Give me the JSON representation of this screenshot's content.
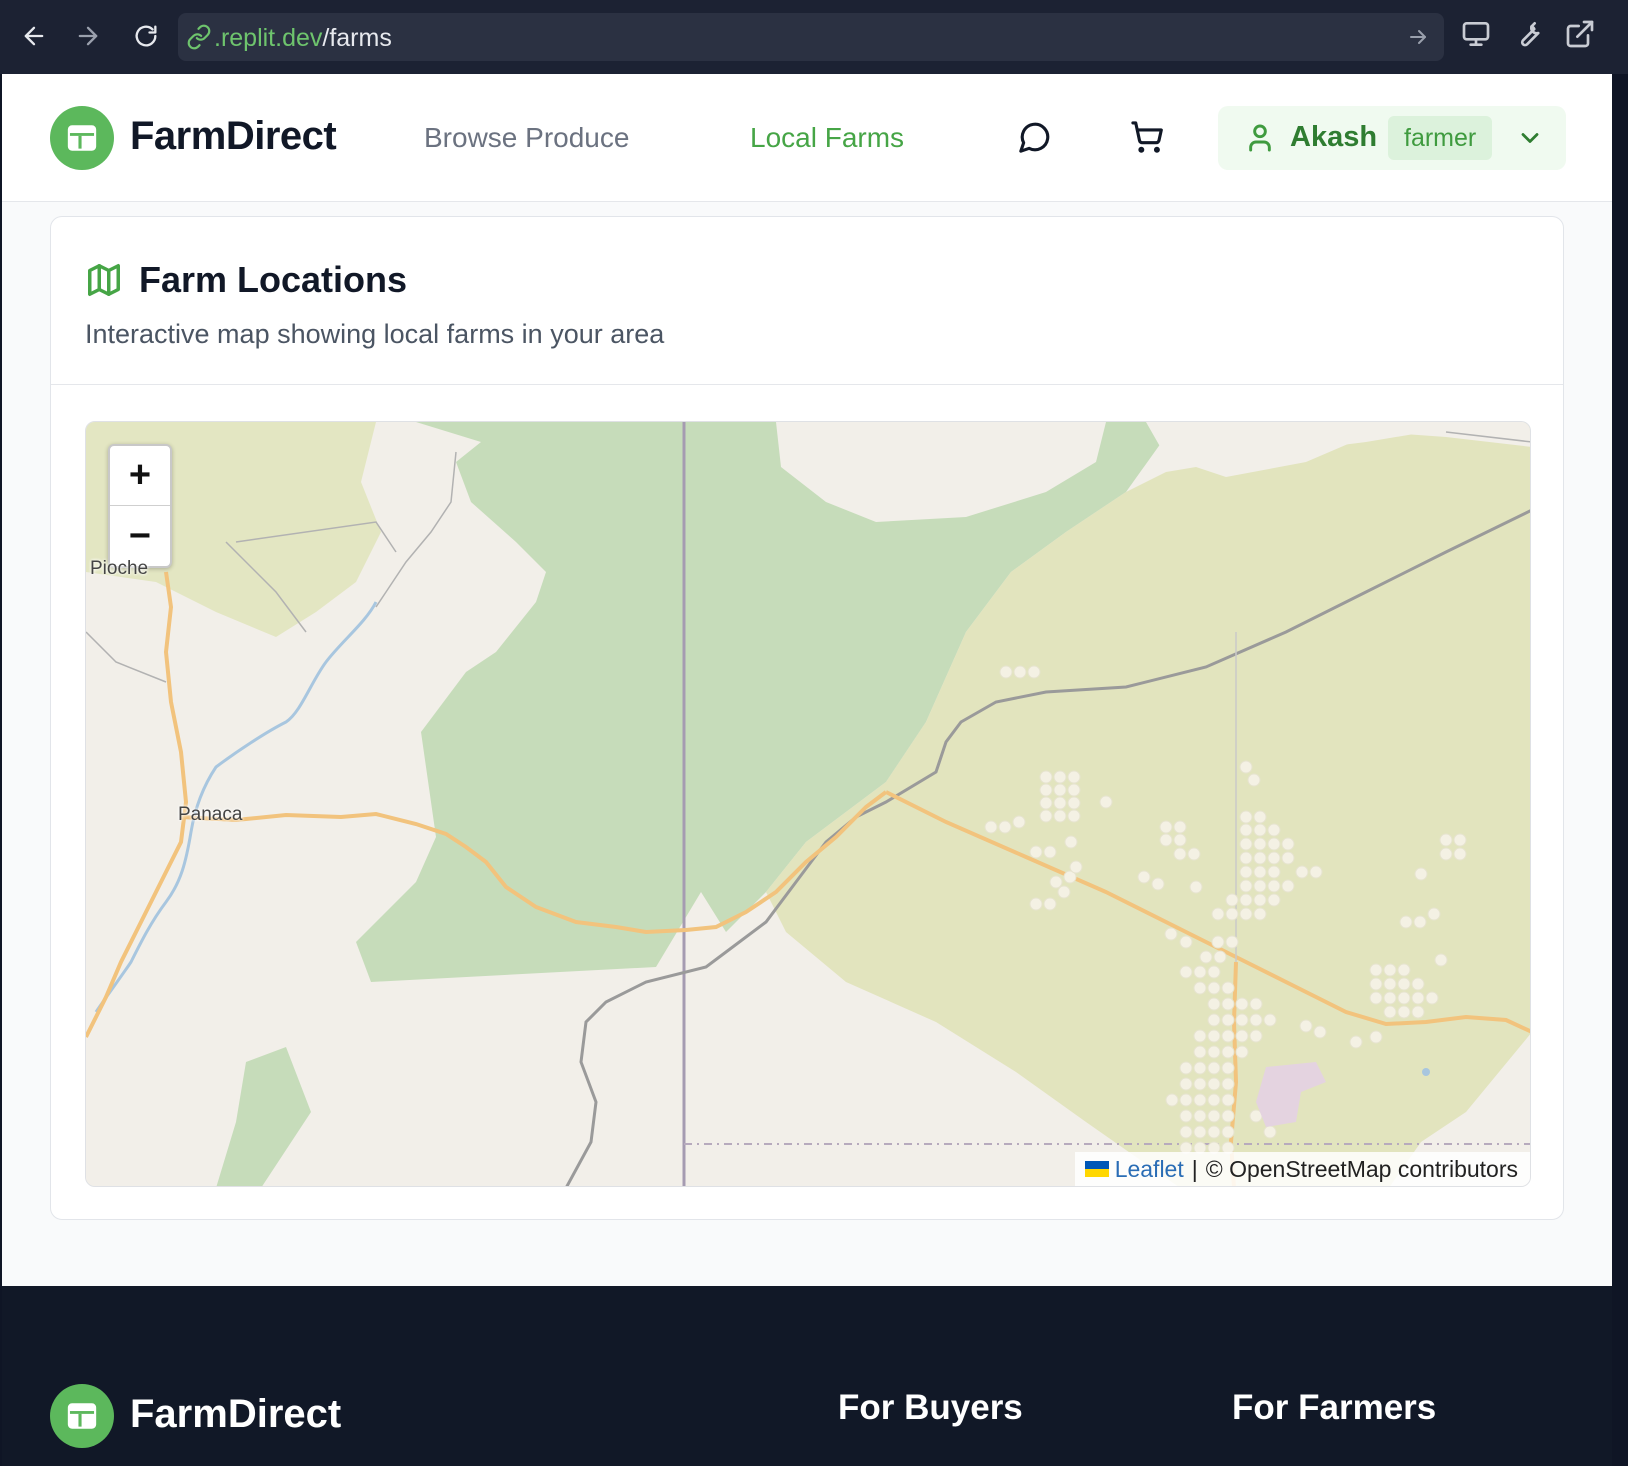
{
  "browser": {
    "url_domain": ".replit.dev",
    "url_path": "/farms",
    "icons": [
      "back-arrow-icon",
      "forward-arrow-icon",
      "reload-icon",
      "link-icon",
      "go-arrow-icon",
      "monitor-icon",
      "wrench-icon",
      "external-link-icon"
    ]
  },
  "header": {
    "brand": "FarmDirect",
    "nav": {
      "browse": "Browse Produce",
      "farms": "Local Farms"
    },
    "active_nav": "farms",
    "user": {
      "name": "Akash",
      "role": "farmer"
    }
  },
  "card": {
    "title": "Farm Locations",
    "subtitle": "Interactive map showing local farms in your area"
  },
  "map": {
    "zoom_in": "+",
    "zoom_out": "−",
    "places": {
      "pioche": "Pioche",
      "panaca": "Panaca"
    },
    "attribution": {
      "leaflet": "Leaflet",
      "separator": "|",
      "osm": "© OpenStreetMap contributors"
    }
  },
  "footer": {
    "brand": "FarmDirect",
    "col_buyers": "For Buyers",
    "col_farmers": "For Farmers"
  },
  "colors": {
    "brand_green": "#5cb85c",
    "active_link": "#46a546",
    "footer_bg": "#111827"
  }
}
